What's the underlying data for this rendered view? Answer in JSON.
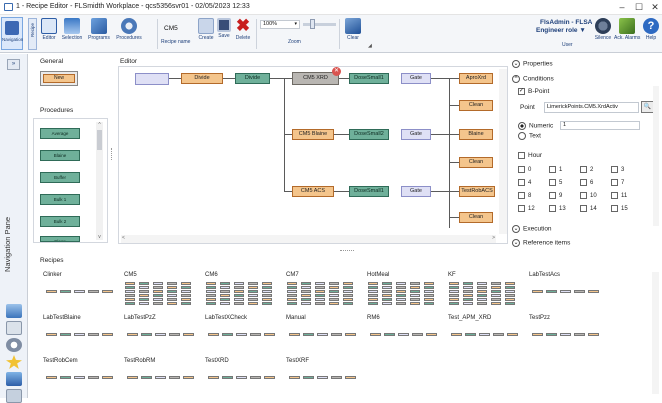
{
  "window": {
    "title": "1 - Recipe Editor - FLSmidth Workplace - qcs5356svr01 - 02/05/2023 12:33",
    "minimize": "–",
    "maximize": "☐",
    "close": "✕"
  },
  "ribbon": {
    "navigation": "Navigation",
    "recipe_tab": "Recipe",
    "editor": "Editor",
    "selection": "Selection",
    "programs": "Programs",
    "procedures": "Procedures",
    "recipe_name_value": "CM5",
    "recipe_name_label": "Recipe name",
    "create": "Create",
    "save": "Save",
    "delete": "Delete",
    "zoom_value": "100%",
    "zoom_label": "Zoom",
    "clear": "Clear",
    "user_name": "FlsAdmin - FLSA",
    "user_role": "Engineer role",
    "user_label": "User",
    "silence": "Silence",
    "ack_alarms": "Ack. Alarms",
    "help": "Help"
  },
  "navpane": {
    "label": "Navigation Pane"
  },
  "general": {
    "title": "General",
    "new_button": "New"
  },
  "procedures": {
    "title": "Procedures",
    "items": [
      "Average",
      "Blaine",
      "Buffer",
      "Bulk 1",
      "Bulk 2",
      "Clean"
    ]
  },
  "editor": {
    "title": "Editor",
    "row1": {
      "divide_or": "Divide",
      "divide_gr": "Divide",
      "start": "CM5 XRD",
      "dose": "DoseSmall1",
      "gate": "Gate",
      "out1": "AproXrd",
      "clean": "Clean"
    },
    "row2": {
      "start": "CM5 Blaine",
      "dose": "DoseSmall2",
      "gate": "Gate",
      "out1": "Blaine",
      "clean": "Clean"
    },
    "row3": {
      "start": "CM5 ACS",
      "dose": "DoseSmall1",
      "gate": "Gate",
      "out1": "TestRobACS",
      "clean": "Clean"
    }
  },
  "properties": {
    "properties_header": "Properties",
    "conditions_header": "Conditions",
    "bpoint_label": "B-Point",
    "point_label": "Point",
    "point_value": "LimerickPoints.CM5.XrdActiv",
    "numeric_label": "Numeric",
    "numeric_value": "1",
    "text_label": "Text",
    "hour_label": "Hour",
    "hours": [
      "0",
      "1",
      "2",
      "3",
      "4",
      "5",
      "6",
      "7",
      "8",
      "9",
      "10",
      "11",
      "12",
      "13",
      "14",
      "15"
    ],
    "execution_header": "Execution",
    "reference_header": "Reference items"
  },
  "recipes": {
    "title": "Recipes",
    "items": [
      "Clinker",
      "CM5",
      "CM6",
      "CM7",
      "HotMeal",
      "KF",
      "LabTestAcs",
      "LabTestBlaine",
      "LabTestPzZ",
      "LabTestXCheck",
      "Manual",
      "RM6",
      "Test_APM_XRD",
      "TestPzz",
      "TestRobCem",
      "TestRobRM",
      "TestXRD",
      "TestXRF"
    ]
  },
  "colors": {
    "accent": "#1d3f7a",
    "node_orange": "#f4c58c",
    "node_green": "#6fb09a",
    "node_lav": "#dfe0f5",
    "delete_red": "#c81e1e"
  }
}
